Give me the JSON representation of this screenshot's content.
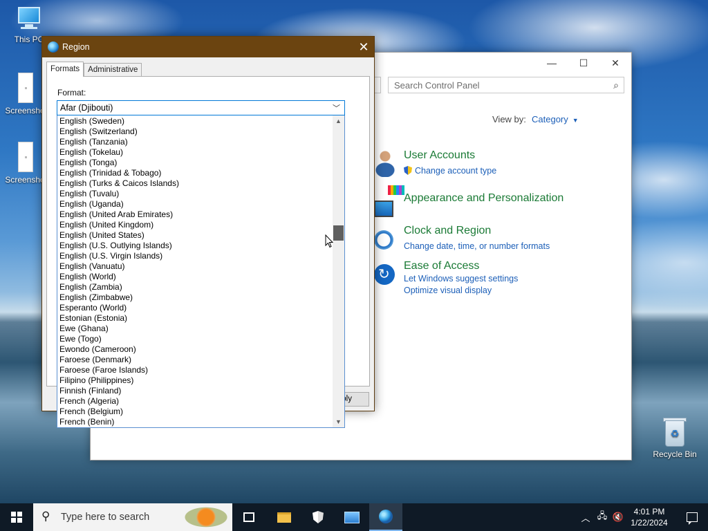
{
  "desktop": {
    "icons": [
      {
        "label": "This PC"
      },
      {
        "label": "Screensho"
      },
      {
        "label": "Screensho"
      },
      {
        "label": "Recycle Bin"
      }
    ]
  },
  "control_panel": {
    "search_placeholder": "Search Control Panel",
    "view_by_label": "View by:",
    "view_by_value": "Category",
    "categories": [
      {
        "title": "User Accounts",
        "links": [
          "Change account type"
        ]
      },
      {
        "title": "Appearance and Personalization",
        "links": []
      },
      {
        "title": "Clock and Region",
        "links": [
          "Change date, time, or number formats"
        ]
      },
      {
        "title": "Ease of Access",
        "links": [
          "Let Windows suggest settings",
          "Optimize visual display"
        ]
      }
    ]
  },
  "region_dialog": {
    "title": "Region",
    "close_glyph": "✕",
    "tabs": [
      "Formats",
      "Administrative"
    ],
    "active_tab": "Formats",
    "format_label": "Format:",
    "selected_format": "Afar (Djibouti)",
    "apply_label": "Apply",
    "dropdown_items": [
      "English (Sweden)",
      "English (Switzerland)",
      "English (Tanzania)",
      "English (Tokelau)",
      "English (Tonga)",
      "English (Trinidad & Tobago)",
      "English (Turks & Caicos Islands)",
      "English (Tuvalu)",
      "English (Uganda)",
      "English (United Arab Emirates)",
      "English (United Kingdom)",
      "English (United States)",
      "English (U.S. Outlying Islands)",
      "English (U.S. Virgin Islands)",
      "English (Vanuatu)",
      "English (World)",
      "English (Zambia)",
      "English (Zimbabwe)",
      "Esperanto (World)",
      "Estonian (Estonia)",
      "Ewe (Ghana)",
      "Ewe (Togo)",
      "Ewondo (Cameroon)",
      "Faroese (Denmark)",
      "Faroese (Faroe Islands)",
      "Filipino (Philippines)",
      "Finnish (Finland)",
      "French (Algeria)",
      "French (Belgium)",
      "French (Benin)"
    ]
  },
  "taskbar": {
    "search_placeholder": "Type here to search",
    "time": "4:01 PM",
    "date": "1/22/2024"
  },
  "colors": {
    "dialog_titlebar": "#6b4410",
    "cp_heading": "#1a7a35",
    "cp_link": "#1c5fb8",
    "taskbar": "#0f1a26"
  }
}
